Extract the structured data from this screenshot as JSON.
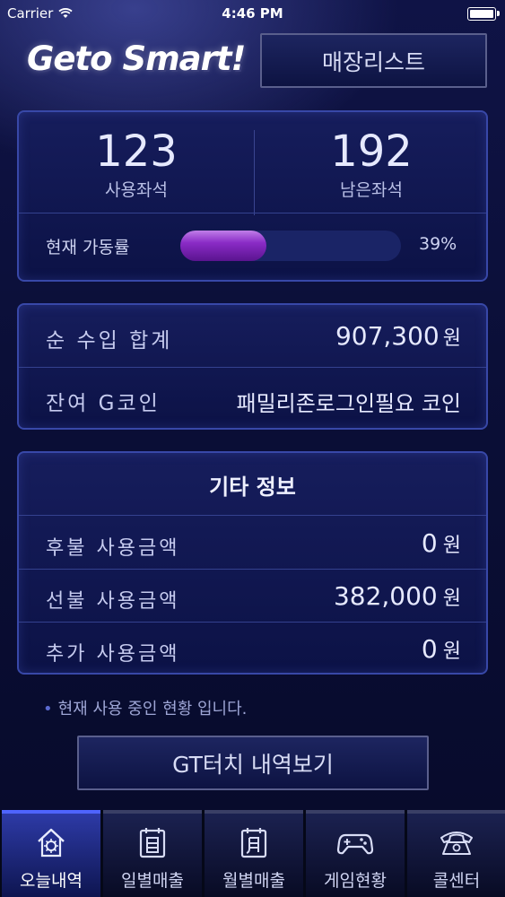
{
  "status": {
    "carrier": "Carrier",
    "time": "4:46 PM"
  },
  "header": {
    "logo_text": "Geto Smart!",
    "store_list_label": "매장리스트"
  },
  "seats": {
    "used_value": "123",
    "used_label": "사용좌석",
    "remaining_value": "192",
    "remaining_label": "남은좌석",
    "utilization_label": "현재 가동률",
    "utilization_text": "39%",
    "utilization_fraction": 0.39
  },
  "income": {
    "net_label": "순 수입 합계",
    "net_value": "907,300",
    "net_unit": "원",
    "gcoin_label": "잔여 G코인",
    "gcoin_value": "패밀리존로그인필요 코인"
  },
  "other_info": {
    "title": "기타 정보",
    "rows": [
      {
        "label": "후불 사용금액",
        "value": "0",
        "unit": "원"
      },
      {
        "label": "선불 사용금액",
        "value": "382,000",
        "unit": "원"
      },
      {
        "label": "추가 사용금액",
        "value": "0",
        "unit": "원"
      }
    ]
  },
  "note": "현재 사용 중인 현황 입니다.",
  "gt_button_label": "GT터치 내역보기",
  "tabs": [
    {
      "label": "오늘내역",
      "icon": "home-icon",
      "active": true
    },
    {
      "label": "일별매출",
      "icon": "daily-calendar-icon",
      "active": false
    },
    {
      "label": "월별매출",
      "icon": "monthly-calendar-icon",
      "active": false
    },
    {
      "label": "게임현황",
      "icon": "gamepad-icon",
      "active": false
    },
    {
      "label": "콜센터",
      "icon": "phone-icon",
      "active": false
    }
  ],
  "colors": {
    "accent": "#4e64ff",
    "progress": "#8a2bc6",
    "panel_border": "#3848a8"
  }
}
